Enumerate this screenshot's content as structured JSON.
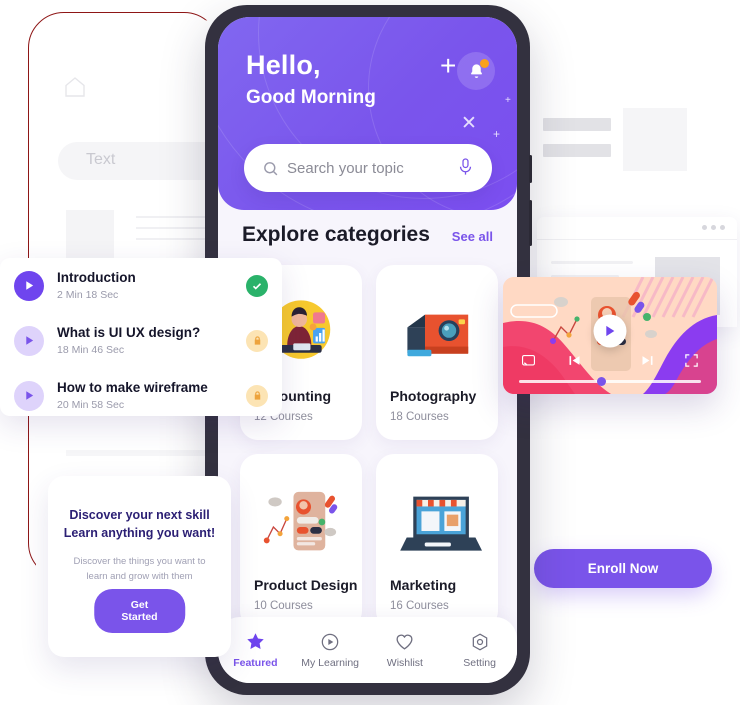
{
  "colors": {
    "brand_purple": "#7a54ea",
    "header_gradient_start": "#8167f0",
    "header_gradient_end": "#7b4ef0",
    "phone_frame": "#33313f",
    "screen_bg": "#f7f5fc",
    "success_green": "#2ab26a",
    "lock_amber": "#fce4b4",
    "notification_orange": "#f9a11b",
    "wireframe_outline": "#8e1616"
  },
  "wireframe_phone": {
    "home_icon": "home-icon",
    "search_placeholder": "Text"
  },
  "phone": {
    "header": {
      "greeting": "Hello,",
      "subgreeting": "Good Morning",
      "bell_icon": "bell-icon",
      "has_notification": true,
      "search": {
        "placeholder": "Search your topic",
        "search_icon": "search-icon",
        "mic_icon": "microphone-icon"
      }
    },
    "explore": {
      "title": "Explore categories",
      "see_all": "See all",
      "cards": [
        {
          "title": "Accounting",
          "courses": "12 Courses",
          "art": "accounting-illustration"
        },
        {
          "title": "Photography",
          "courses": "18 Courses",
          "art": "camera-illustration"
        },
        {
          "title": "Product Design",
          "courses": "10 Courses",
          "art": "mobile-design-illustration"
        },
        {
          "title": "Marketing",
          "courses": "16 Courses",
          "art": "laptop-shop-illustration"
        }
      ]
    },
    "bottom_nav": [
      {
        "label": "Featured",
        "icon": "star-icon",
        "active": true
      },
      {
        "label": "My Learning",
        "icon": "play-circle-icon",
        "active": false
      },
      {
        "label": "Wishlist",
        "icon": "heart-icon",
        "active": false
      },
      {
        "label": "Setting",
        "icon": "gear-hexagon-icon",
        "active": false
      }
    ]
  },
  "lesson_list": [
    {
      "title": "Introduction",
      "duration": "2 Min 18 Sec",
      "status": "completed",
      "status_icon": "check-icon",
      "play_state": "active"
    },
    {
      "title": "What is UI UX design?",
      "duration": "18 Min 46 Sec",
      "status": "locked",
      "status_icon": "lock-icon",
      "play_state": "inactive"
    },
    {
      "title": "How to make wireframe",
      "duration": "20 Min 58 Sec",
      "status": "locked",
      "status_icon": "lock-icon",
      "play_state": "inactive"
    }
  ],
  "discover_card": {
    "title_line1": "Discover your next skill",
    "title_line2": "Learn anything you want!",
    "subtitle_line1": "Discover the things you want to",
    "subtitle_line2": "learn and grow with them",
    "button": "Get Started"
  },
  "video_player": {
    "play_icon": "play-icon",
    "cast_icon": "cast-icon",
    "previous_icon": "previous-track-icon",
    "next_icon": "next-track-icon",
    "fullscreen_icon": "fullscreen-icon",
    "progress_percent": 45
  },
  "enroll": {
    "label": "Enroll Now"
  },
  "browser_mock": {
    "dots_icon": "window-dots-icon"
  }
}
